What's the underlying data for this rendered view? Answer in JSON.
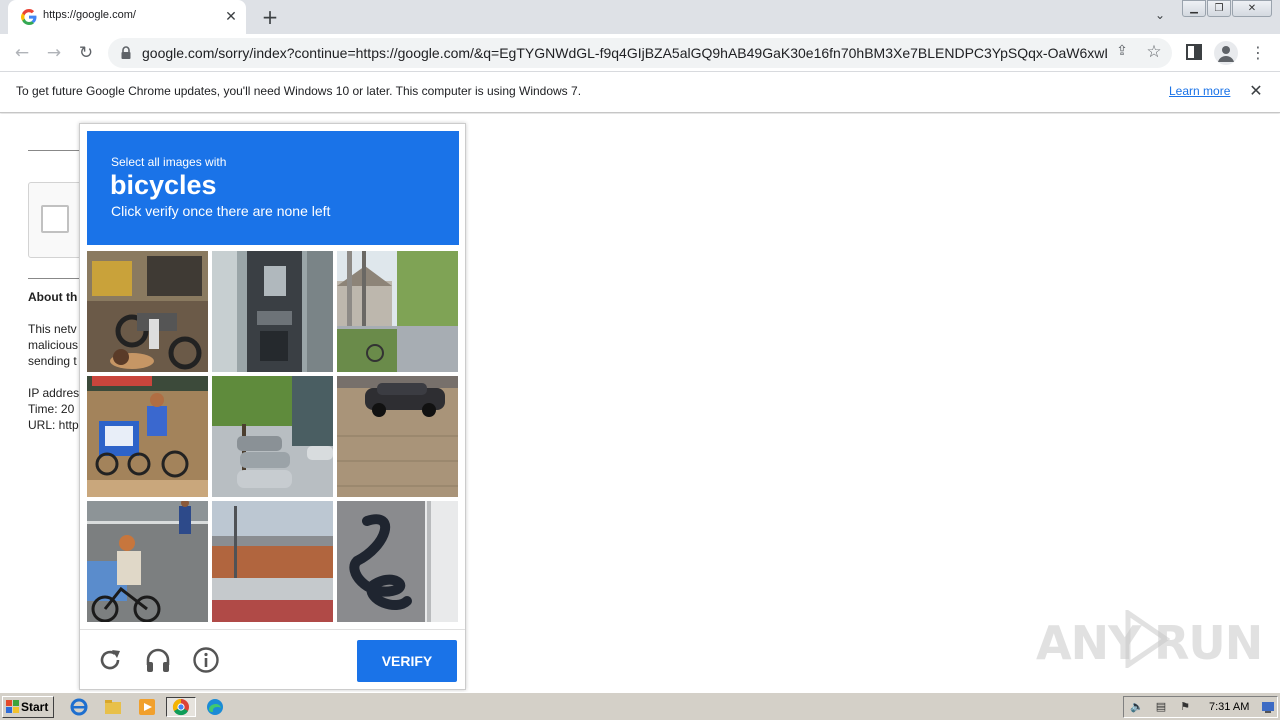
{
  "browser": {
    "tab_title": "https://google.com/",
    "url": "google.com/sorry/index?continue=https://google.com/&q=EgTYGNWdGL-f9q4GIjBZA5alGQ9hAB49GaK30e16fn70hBM3Xe7BLENDPC3YpSQqx-OaW6xwL..."
  },
  "infobar": {
    "message": "To get future Google Chrome updates, you'll need Windows 10 or later. This computer is using Windows 7.",
    "learn_more": "Learn more"
  },
  "page": {
    "about_heading": "About th",
    "para_line1": "This netv",
    "para_line2": "malicious",
    "para_line3": "sending t",
    "ip_line": "IP addres",
    "time_line": "Time: 20",
    "url_line": "URL: http"
  },
  "captcha": {
    "instruction": "Select all images with",
    "target": "bicycles",
    "hint": "Click verify once there are none left",
    "verify_label": "VERIFY",
    "accent": "#1a73e8",
    "tiles": [
      {
        "name": "tile-motorcycle-street",
        "icon": "motorcycle"
      },
      {
        "name": "tile-ticket-machine",
        "icon": "ticket-machine"
      },
      {
        "name": "tile-street-trees",
        "icon": "street"
      },
      {
        "name": "tile-cargo-tricycle",
        "icon": "tricycle"
      },
      {
        "name": "tile-parked-cars",
        "icon": "cars"
      },
      {
        "name": "tile-parked-car-pavement",
        "icon": "car"
      },
      {
        "name": "tile-child-bicycle",
        "icon": "bicycle"
      },
      {
        "name": "tile-station-fence",
        "icon": "station"
      },
      {
        "name": "tile-graffiti-wall",
        "icon": "graffiti"
      }
    ]
  },
  "watermark": {
    "text_left": "ANY",
    "text_right": "RUN"
  },
  "taskbar": {
    "start_label": "Start",
    "clock": "7:31 AM"
  }
}
